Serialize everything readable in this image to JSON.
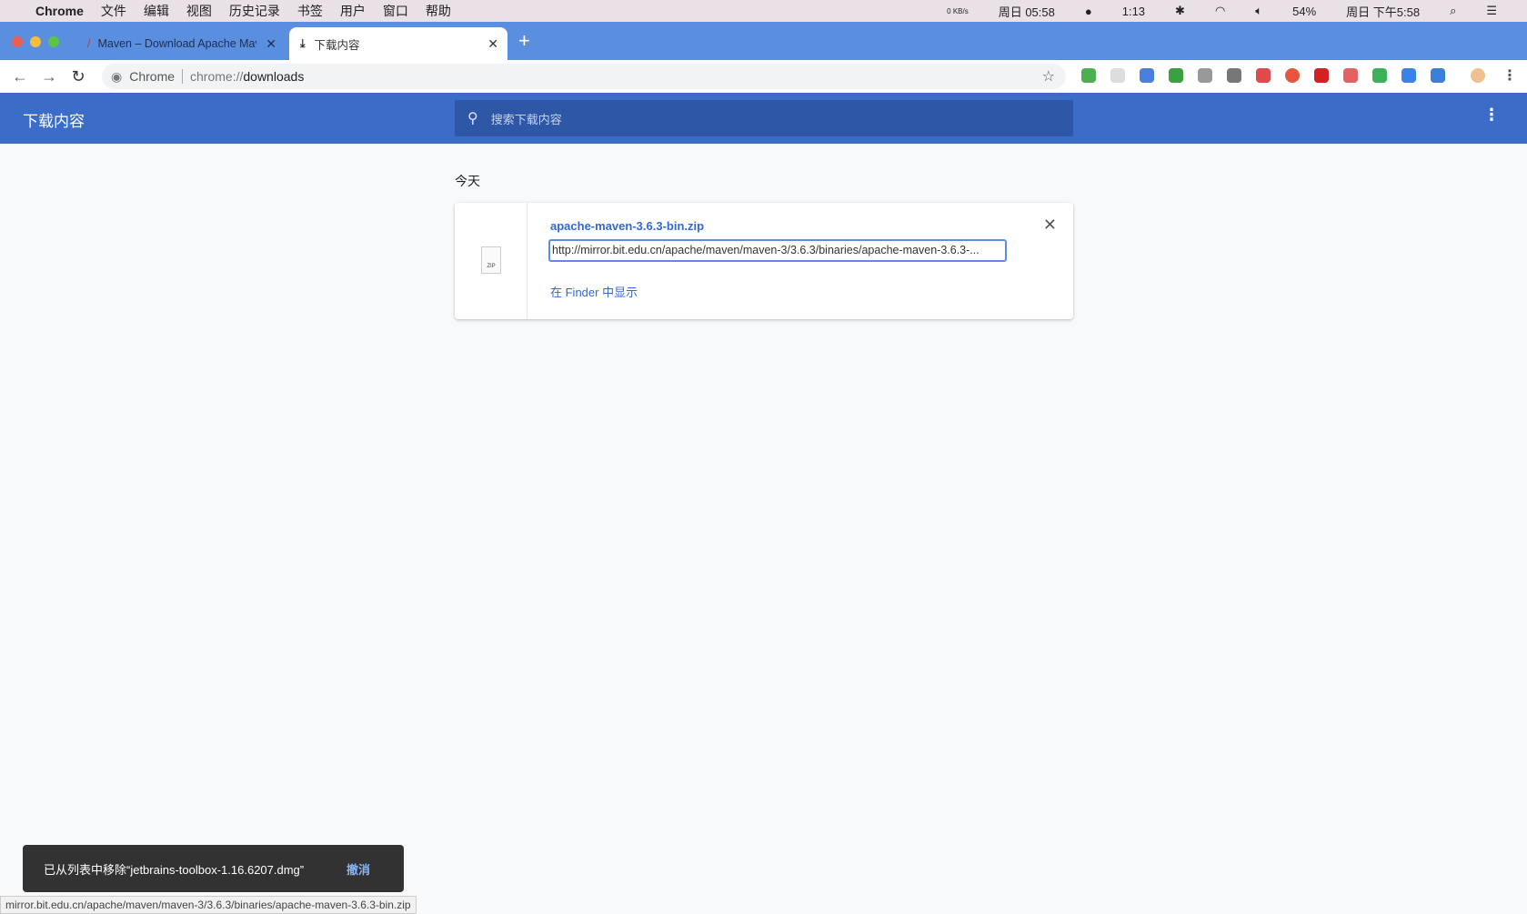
{
  "menubar": {
    "app": "Chrome",
    "items": [
      "文件",
      "编辑",
      "视图",
      "历史记录",
      "书签",
      "用户",
      "窗口",
      "帮助"
    ],
    "net": "0 KB/s",
    "clock1": "周日 05:58",
    "battery_time": "1:13",
    "battery": "54%",
    "clock2": "周日 下午5:58"
  },
  "tabs": [
    {
      "label": "Maven – Download Apache Maven",
      "icon": "maven-feather-icon"
    },
    {
      "label": "下载内容",
      "icon": "download-icon"
    }
  ],
  "toolbar": {
    "site": "Chrome",
    "url_prefix": "chrome://",
    "url_host": "downloads"
  },
  "header": {
    "title": "下载内容",
    "search_placeholder": "搜索下载内容"
  },
  "section": "今天",
  "download": {
    "filename": "apache-maven-3.6.3-bin.zip",
    "url": "http://mirror.bit.edu.cn/apache/maven/maven-3/3.6.3/binaries/apache-maven-3.6.3-...",
    "file_type": "ZIP",
    "show_in_finder": "在 Finder 中显示"
  },
  "toast": {
    "message": "已从列表中移除“jetbrains-toolbox-1.16.6207.dmg”",
    "undo": "撤消"
  },
  "status_url": "mirror.bit.edu.cn/apache/maven/maven-3/3.6.3/binaries/apache-maven-3.6.3-bin.zip",
  "colors": {
    "header": "#3b6cc8",
    "tabbar": "#5a8fdf",
    "link": "#3367d6"
  }
}
